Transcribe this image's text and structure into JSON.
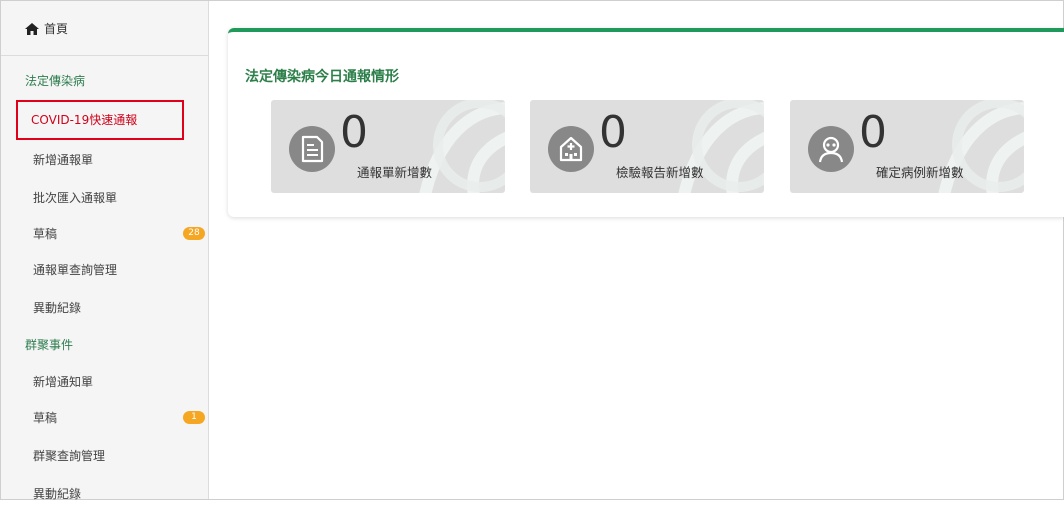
{
  "sidebar": {
    "home_label": "首頁",
    "sections": [
      {
        "title": "法定傳染病",
        "items": [
          {
            "label": "COVID-19快速通報",
            "active": true
          },
          {
            "label": "新增通報單"
          },
          {
            "label": "批次匯入通報單"
          },
          {
            "label": "草稿",
            "badge": "28"
          },
          {
            "label": "通報單查詢管理"
          },
          {
            "label": "異動紀錄"
          }
        ]
      },
      {
        "title": "群聚事件",
        "items": [
          {
            "label": "新增通知單"
          },
          {
            "label": "草稿",
            "badge": "1"
          },
          {
            "label": "群聚查詢管理"
          },
          {
            "label": "異動紀錄"
          }
        ]
      }
    ]
  },
  "main": {
    "panel_title": "法定傳染病今日通報情形",
    "cards": [
      {
        "value": "0",
        "label": "通報單新增數",
        "icon": "document-icon"
      },
      {
        "value": "0",
        "label": "檢驗報告新增數",
        "icon": "hospital-icon"
      },
      {
        "value": "0",
        "label": "確定病例新增數",
        "icon": "patient-icon"
      }
    ]
  },
  "colors": {
    "accent_green": "#1f9a5b",
    "title_green": "#2d7f4a",
    "active_red": "#d0021b",
    "badge_orange": "#f5a623"
  }
}
